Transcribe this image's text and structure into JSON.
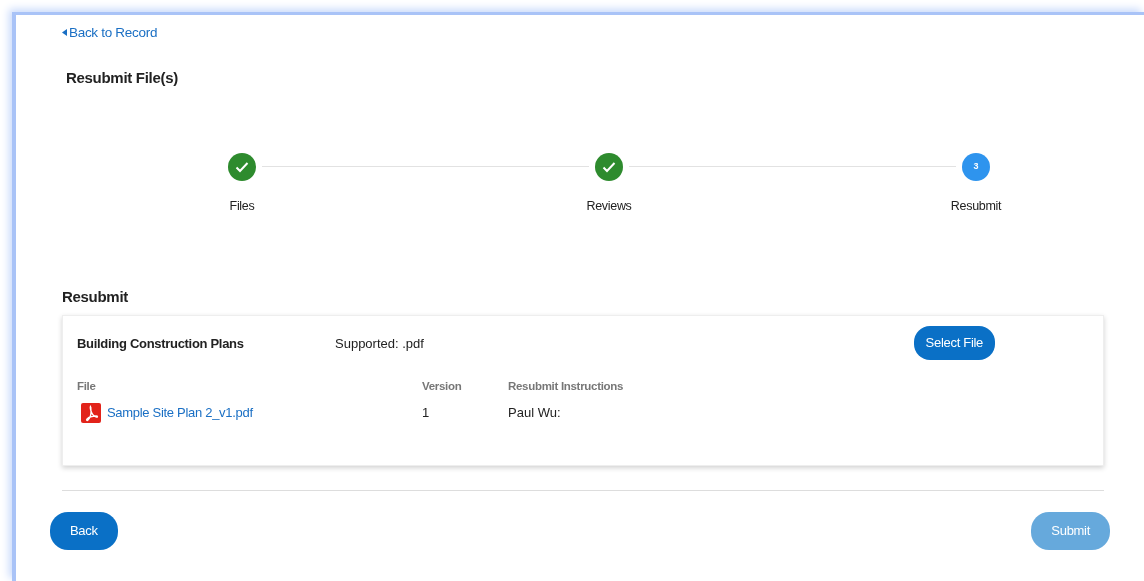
{
  "back_link": "Back to Record",
  "page_title": "Resubmit File(s)",
  "steps": [
    {
      "label": "Files",
      "completed": true
    },
    {
      "label": "Reviews",
      "completed": true
    },
    {
      "label": "Resubmit",
      "completed": false,
      "number": "3"
    }
  ],
  "section_title": "Resubmit",
  "file_card": {
    "title": "Building Construction Plans",
    "supported": "Supported: .pdf",
    "select_button": "Select File",
    "columns": [
      "File",
      "Version",
      "Resubmit Instructions"
    ],
    "rows": [
      {
        "file": "Sample Site Plan 2_v1.pdf",
        "version": "1",
        "instructions": "Paul Wu:"
      }
    ]
  },
  "buttons": [
    {
      "label": "Back",
      "disabled": false
    },
    {
      "label": "Submit",
      "disabled": true
    }
  ]
}
